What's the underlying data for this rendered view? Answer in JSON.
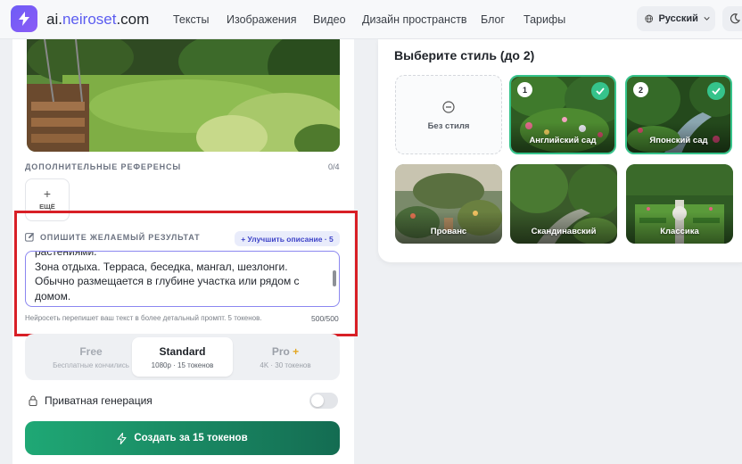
{
  "header": {
    "logo_text": "ai.",
    "logo_domain": "neiroset",
    "logo_tld": ".com",
    "nav": [
      "Тексты",
      "Изображения",
      "Видео",
      "Дизайн пространств",
      "Блог",
      "Тарифы"
    ],
    "language": "Русский",
    "accent": "#5b5cf0"
  },
  "left_panel": {
    "references_title": "ДОПОЛНИТЕЛЬНЫЕ РЕФЕРЕНСЫ",
    "references_count": "0/4",
    "more_plus": "+",
    "more_label": "ЕЩЁ",
    "description_title": "ОПИШИТЕ ЖЕЛАЕМЫЙ РЕЗУЛЬТАТ",
    "improve_button": "+ Улучшить описание · 5",
    "prompt_text": "растениями.\nЗона отдыха. Терраса, беседка, мангал, шезлонги. Обычно размещается в глубине участка или рядом с домом.\nСад и огород. Грядки, плодовые деревья, ягодные кустарники. Располагаются в солнечной",
    "hint": "Нейросеть перепишет ваш текст в более детальный промпт. 5 токенов.",
    "char_counter": "500/500",
    "tiers": [
      {
        "name": "Free",
        "sub": "Бесплатные кончились"
      },
      {
        "name": "Standard",
        "sub": "1080p · 15 токенов"
      },
      {
        "name": "Pro",
        "star": "+",
        "sub": "4K · 30 токенов"
      }
    ],
    "selected_tier": "Standard",
    "private_label": "Приватная генерация",
    "private_enabled": false,
    "create_button": "Создать за 15 токенов"
  },
  "right_panel": {
    "title": "Выберите стиль (до 2)",
    "styles": [
      {
        "label": "Без стиля",
        "icon": "minus-circle-icon",
        "selected": false
      },
      {
        "label": "Английский сад",
        "order": "1",
        "selected": true
      },
      {
        "label": "Японский сад",
        "order": "2",
        "selected": true
      },
      {
        "label": "Прованс",
        "selected": false
      },
      {
        "label": "Скандинавский",
        "selected": false
      },
      {
        "label": "Классика",
        "selected": false
      }
    ],
    "selected_color": "#35c38b"
  }
}
